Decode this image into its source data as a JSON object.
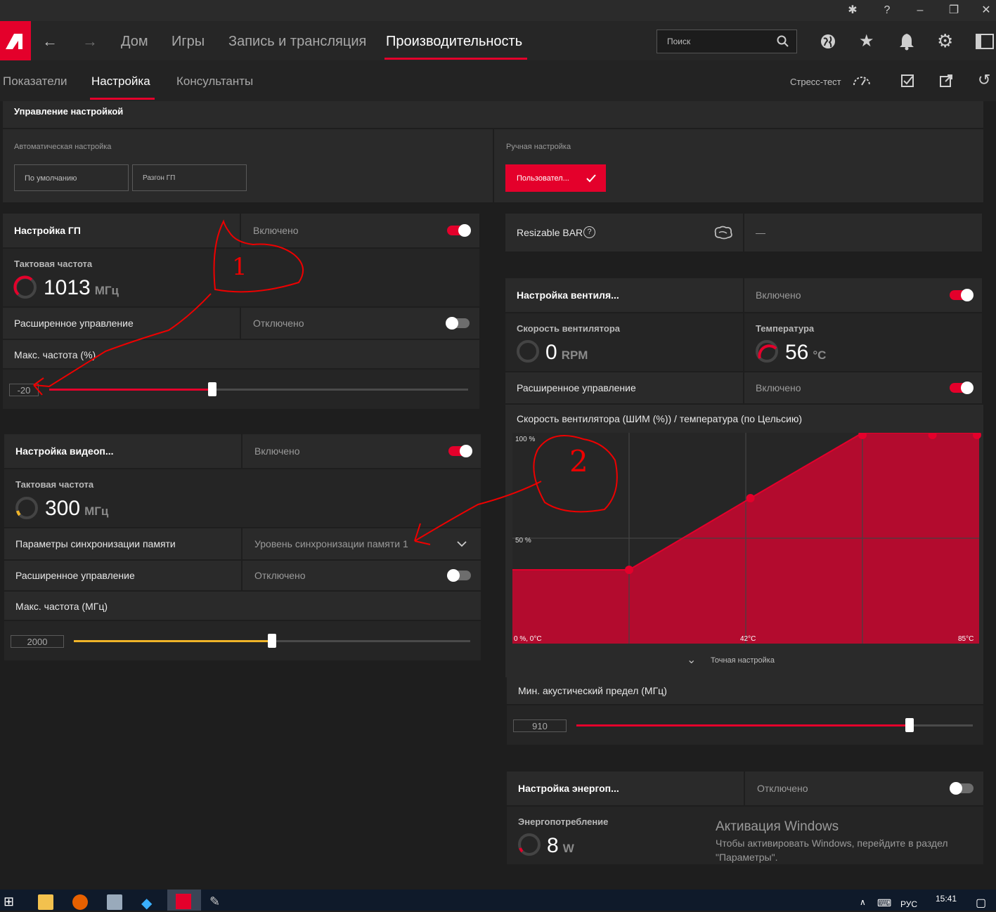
{
  "nav": {
    "home": "Дом",
    "games": "Игры",
    "record": "Запись и трансляция",
    "performance": "Производительность",
    "search_placeholder": "Поиск"
  },
  "subnav": {
    "metrics": "Показатели",
    "tuning": "Настройка",
    "advisors": "Консультанты",
    "stress_test": "Стресс-тест"
  },
  "tuning_control": {
    "title": "Управление настройкой",
    "auto_label": "Автоматическая настройка",
    "default_btn": "По умолчанию",
    "gpu_oc_btn": "Разгон ГП",
    "manual_label": "Ручная настройка",
    "custom_btn": "Пользовател..."
  },
  "gpu_tuning": {
    "title": "Настройка ГП",
    "status": "Включено",
    "clock_title": "Тактовая частота",
    "clock_value": "1013",
    "clock_unit": "МГц",
    "advanced_label": "Расширенное управление",
    "advanced_status": "Отключено",
    "max_freq_label": "Макс. частота (%)",
    "max_freq_value": "-20",
    "max_freq_fraction": 0.39
  },
  "vram_tuning": {
    "title": "Настройка видеоп...",
    "status": "Включено",
    "clock_title": "Тактовая частота",
    "clock_value": "300",
    "clock_unit": "МГц",
    "timing_label": "Параметры синхронизации памяти",
    "timing_value": "Уровень синхронизации памяти 1",
    "advanced_label": "Расширенное управление",
    "advanced_status": "Отключено",
    "max_freq_label": "Макс. частота (МГц)",
    "max_freq_value": "2000",
    "max_freq_fraction": 0.5
  },
  "resizable_bar": {
    "label": "Resizable BAR",
    "value": "—"
  },
  "fan_tuning": {
    "title": "Настройка вентиля...",
    "status": "Включено",
    "speed_title": "Скорость вентилятора",
    "speed_value": "0",
    "speed_unit": "RPM",
    "temp_title": "Температура",
    "temp_value": "56",
    "temp_unit": "°C",
    "advanced_label": "Расширенное управление",
    "advanced_status": "Включено",
    "curve_label": "Скорость вентилятора (ШИМ (%)) / температура (по Цельсию)",
    "fine_tune": "Точная настройка",
    "acoustic_label": "Мин. акустический предел (МГц)",
    "acoustic_value": "910",
    "acoustic_fraction": 0.84
  },
  "chart_data": {
    "type": "area",
    "x": [
      0,
      25,
      51,
      75,
      90,
      100
    ],
    "values": [
      35,
      35,
      69,
      100,
      100,
      100
    ],
    "y_tick_labels": [
      "100 %",
      "50 %"
    ],
    "x_tick_labels": [
      "0 %, 0°C",
      "42°C",
      "85°C"
    ],
    "ylim": [
      0,
      100
    ],
    "grid": true
  },
  "power_tuning": {
    "title": "Настройка энергоп...",
    "status": "Отключено",
    "power_title": "Энергопотребление",
    "power_value": "8",
    "power_unit": "W"
  },
  "windows_activation": {
    "title": "Активация Windows",
    "text1": "Чтобы активировать Windows, перейдите в раздел",
    "text2": "\"Параметры\"."
  },
  "annotations": {
    "one": "1",
    "two": "2"
  },
  "taskbar": {
    "lang": "РУС",
    "time": "15:41"
  },
  "colors": {
    "accent": "#e4002b",
    "vram_slider": "#f0b429"
  }
}
